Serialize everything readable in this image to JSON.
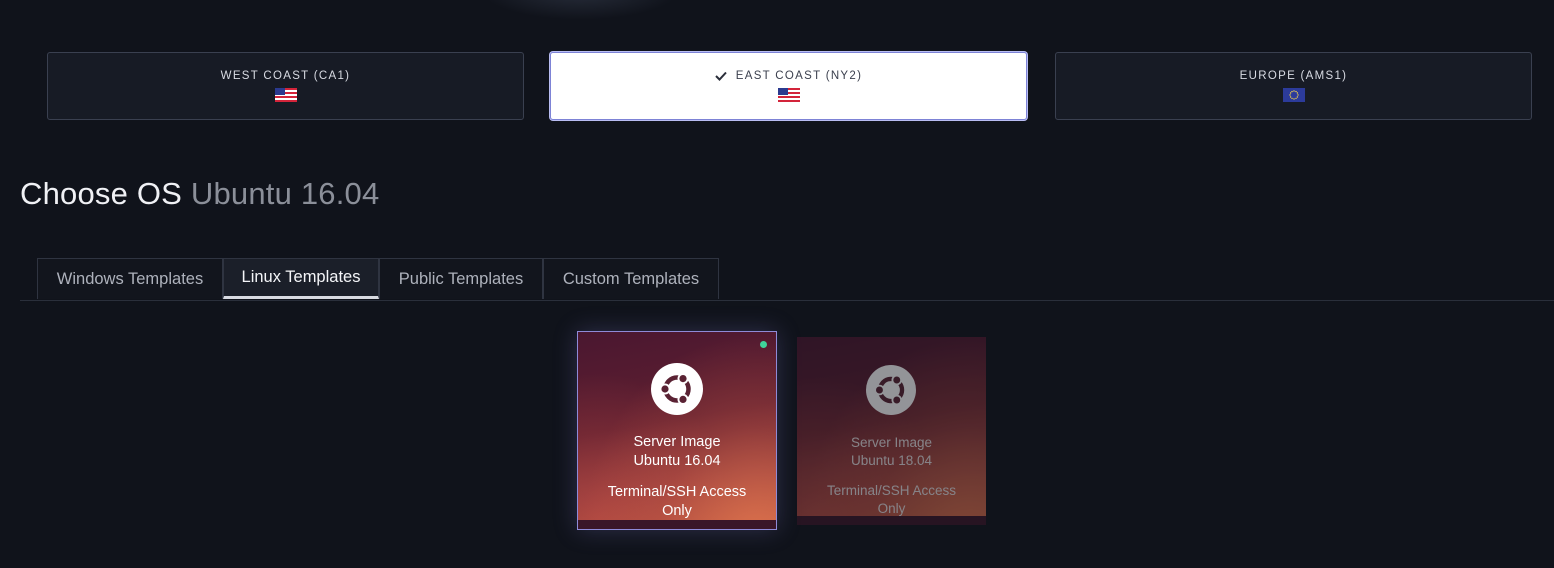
{
  "regions": [
    {
      "label": "WEST COAST (CA1)",
      "flag": "us-flag-icon",
      "selected": false
    },
    {
      "label": "EAST COAST (NY2)",
      "flag": "us-flag-icon",
      "selected": true
    },
    {
      "label": "EUROPE (AMS1)",
      "flag": "eu-flag-icon",
      "selected": false
    }
  ],
  "heading": {
    "title": "Choose OS",
    "selection": "Ubuntu 16.04"
  },
  "tabs": [
    {
      "label": "Windows Templates",
      "active": false
    },
    {
      "label": "Linux Templates",
      "active": true
    },
    {
      "label": "Public Templates",
      "active": false
    },
    {
      "label": "Custom Templates",
      "active": false
    }
  ],
  "templates": [
    {
      "icon": "ubuntu-logo-icon",
      "type": "Server Image",
      "name": "Ubuntu 16.04",
      "access": "Terminal/SSH Access",
      "access2": "Only",
      "selected": true
    },
    {
      "icon": "ubuntu-logo-icon",
      "type": "Server Image",
      "name": "Ubuntu 18.04",
      "access": "Terminal/SSH Access",
      "access2": "Only",
      "selected": false
    }
  ],
  "colors": {
    "background": "#10131b",
    "selected_border": "#7d83d6",
    "status_dot": "#3fd49a",
    "template_gradient_start": "#4a1730",
    "template_gradient_end": "#b5573f"
  }
}
